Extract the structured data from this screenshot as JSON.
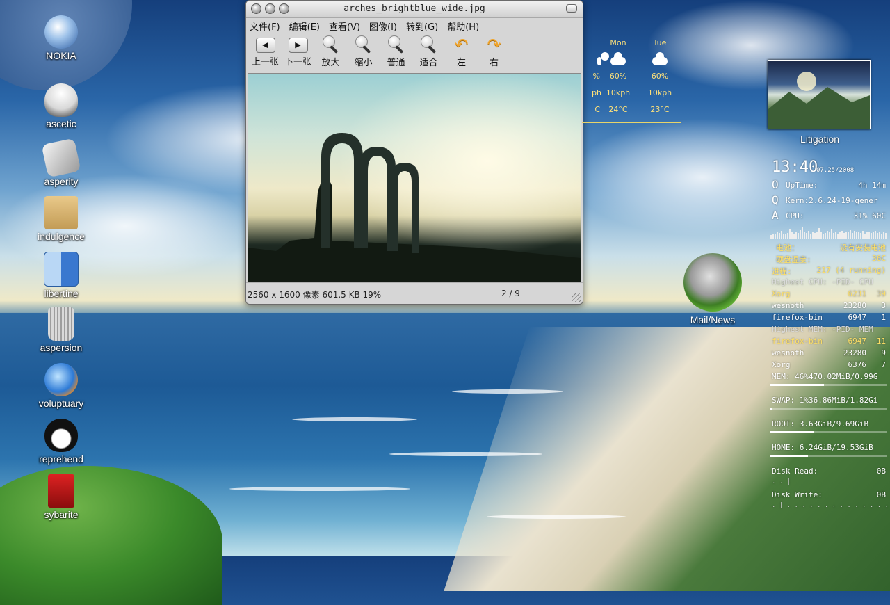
{
  "desktop_icons": [
    {
      "label": "NOKIA",
      "icon": "nokia-bluetooth-icon"
    },
    {
      "label": "ascetic",
      "icon": "robot-icon"
    },
    {
      "label": "asperity",
      "icon": "document-file-icon"
    },
    {
      "label": "indulgence",
      "icon": "folder-icon"
    },
    {
      "label": "libertine",
      "icon": "finder-icon"
    },
    {
      "label": "aspersion",
      "icon": "trash-icon"
    },
    {
      "label": "voluptuary",
      "icon": "browser-globe-icon"
    },
    {
      "label": "reprehend",
      "icon": "penguin-chat-icon"
    },
    {
      "label": "sybarite",
      "icon": "pdf-reader-icon"
    }
  ],
  "viewer": {
    "title": "arches_brightblue_wide.jpg",
    "menu": [
      "文件(F)",
      "编辑(E)",
      "查看(V)",
      "图像(I)",
      "转到(G)",
      "帮助(H)"
    ],
    "toolbar": [
      "上一张",
      "下一张",
      "放大",
      "缩小",
      "普通",
      "适合",
      "左",
      "右"
    ],
    "status_left": "2560 x 1600 像素  601.5 KB   19%",
    "status_right": "2 / 9"
  },
  "weather": {
    "days": [
      "Mon",
      "Tue"
    ],
    "humidity": [
      "60%",
      "60%"
    ],
    "wind": [
      "10kph",
      "10kph"
    ],
    "temp": [
      "24°C",
      "23°C"
    ],
    "partial_cols": [
      "%",
      "ph",
      "C"
    ]
  },
  "photo_widget": {
    "label": "Litigation"
  },
  "mail_icon": {
    "label": "Mail/News"
  },
  "conky": {
    "time": "13:40",
    "date": "07.25/2008",
    "uptime_label": "UpTime:",
    "uptime_value": "4h 14m",
    "kern": "Kern:2.6.24-19-gener",
    "cpu_label": "CPU:",
    "cpu_value": "31% 60C",
    "battery_label": "电池：",
    "battery_value": "没有安装电池",
    "disk_temp_label": "硬盘温度:",
    "disk_temp_value": "36C",
    "proc_label": "进程:",
    "proc_value": "217  (4 running)",
    "cpu_header": "Highest CPU: -PID-  CPU",
    "cpu_rows": [
      {
        "name": "Xorg",
        "pid": "6231",
        "val": "39"
      },
      {
        "name": "wesnoth",
        "pid": "23280",
        "val": "3"
      },
      {
        "name": "firefox-bin",
        "pid": "6947",
        "val": "1"
      }
    ],
    "mem_header": "Highest MEM: -PID-  MEM",
    "mem_rows": [
      {
        "name": "firefox-bin",
        "pid": "6947",
        "val": "11"
      },
      {
        "name": "wesnoth",
        "pid": "23280",
        "val": "9"
      },
      {
        "name": "Xorg",
        "pid": "6376",
        "val": "7"
      }
    ],
    "mem": "MEM: 46%470.02MiB/0.99G",
    "mem_level": 0.46,
    "swap": "SWAP: 1%36.86MiB/1.82Gi",
    "swap_level": 0.01,
    "root": "ROOT:   3.63GiB/9.69GiB",
    "root_level": 0.37,
    "home": "HOME:  6.24GiB/19.53GiB",
    "home_level": 0.32,
    "disk_read_label": "Disk Read:",
    "disk_read_value": "0B",
    "disk_write_label": "Disk Write:",
    "disk_write_value": "0B"
  }
}
